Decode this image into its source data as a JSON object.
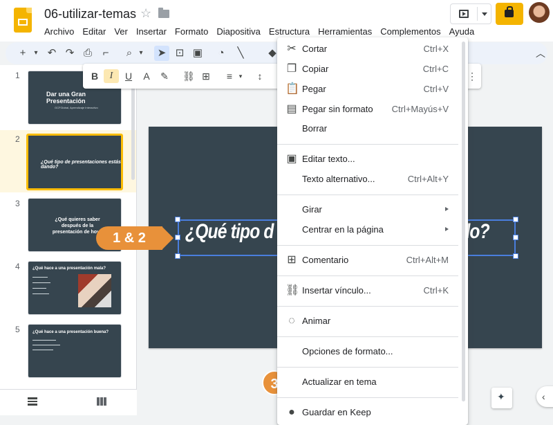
{
  "app": {
    "doc_title": "06-utilizar-temas",
    "menus": [
      "Archivo",
      "Editar",
      "Ver",
      "Insertar",
      "Formato",
      "Diapositiva",
      "Estructura",
      "Herramientas",
      "Complementos",
      "Ayuda"
    ]
  },
  "filmstrip": {
    "slides": [
      {
        "number": "1",
        "title": "Dar una Gran Presentación",
        "subtitle": "GCFGlobal, Aprendizaje Interactivo"
      },
      {
        "number": "2",
        "title": "¿Qué tipo de presentaciones estás dando?"
      },
      {
        "number": "3",
        "title": "¿Qué quieres saber después de la presentación de hoy?"
      },
      {
        "number": "4",
        "title": "¿Qué hace a una presentación mala?"
      },
      {
        "number": "5",
        "title": "¿Qué hace a una presentación buena?"
      }
    ]
  },
  "slide": {
    "text_left": "¿Qué tipo d",
    "text_right": "ndo?"
  },
  "callouts": {
    "step_12": "1 & 2",
    "step_3": "3"
  },
  "context_menu": {
    "items": [
      {
        "label": "Cortar",
        "shortcut": "Ctrl+X",
        "icon": "cut-icon"
      },
      {
        "label": "Copiar",
        "shortcut": "Ctrl+C",
        "icon": "copy-icon"
      },
      {
        "label": "Pegar",
        "shortcut": "Ctrl+V",
        "icon": "paste-icon"
      },
      {
        "label": "Pegar sin formato",
        "shortcut": "Ctrl+Mayús+V",
        "icon": "paste-plain-icon"
      },
      {
        "label": "Borrar",
        "shortcut": ""
      },
      {
        "label": "Editar texto...",
        "shortcut": "",
        "icon": "edit-text-icon"
      },
      {
        "label": "Texto alternativo...",
        "shortcut": "Ctrl+Alt+Y"
      },
      {
        "label": "Girar",
        "shortcut": "",
        "submenu": true
      },
      {
        "label": "Centrar en la página",
        "shortcut": "",
        "submenu": true
      },
      {
        "label": "Comentario",
        "shortcut": "Ctrl+Alt+M",
        "icon": "comment-icon"
      },
      {
        "label": "Insertar vínculo...",
        "shortcut": "Ctrl+K",
        "icon": "link-icon"
      },
      {
        "label": "Animar",
        "shortcut": "",
        "icon": "animate-icon"
      },
      {
        "label": "Opciones de formato...",
        "shortcut": ""
      },
      {
        "label": "Actualizar en tema",
        "shortcut": ""
      },
      {
        "label": "Guardar en Keep",
        "shortcut": "",
        "icon": "keep-icon"
      }
    ]
  },
  "colors": {
    "accent": "#f4b400",
    "slide_bg": "#36454f",
    "callout": "#e8913a",
    "selection": "#4a7ede"
  }
}
